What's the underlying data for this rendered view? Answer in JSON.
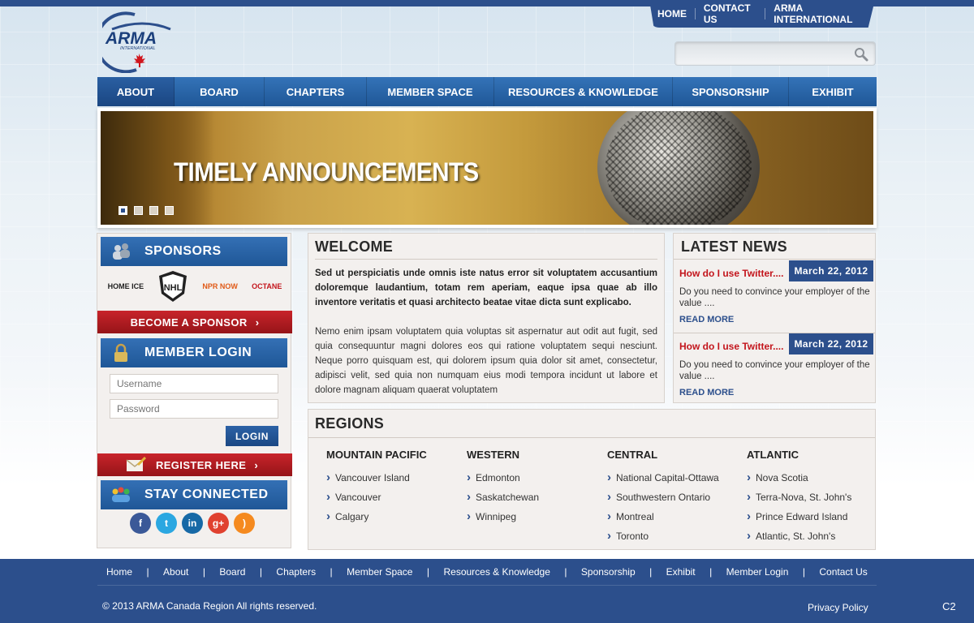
{
  "topnav": {
    "home": "HOME",
    "contact": "CONTACT US",
    "intl": "ARMA INTERNATIONAL"
  },
  "logo": {
    "name": "ARMA",
    "sub": "INTERNATIONAL"
  },
  "search": {
    "placeholder": "",
    "value": ""
  },
  "mainnav": [
    {
      "label": "ABOUT"
    },
    {
      "label": "BOARD"
    },
    {
      "label": "CHAPTERS"
    },
    {
      "label": "MEMBER SPACE"
    },
    {
      "label": "RESOURCES & KNOWLEDGE"
    },
    {
      "label": "SPONSORSHIP"
    },
    {
      "label": "EXHIBIT"
    }
  ],
  "banner": {
    "title": "TIMELY ANNOUNCEMENTS"
  },
  "sidebar": {
    "sponsors_title": "SPONSORS",
    "sponsor_logos": [
      "HOME ICE",
      "NHL",
      "NPR NOW",
      "OCTANE"
    ],
    "become_sponsor": "BECOME A SPONSOR",
    "login_title": "MEMBER LOGIN",
    "username_placeholder": "Username",
    "password_placeholder": "Password",
    "login_button": "LOGIN",
    "register": "REGISTER HERE",
    "stay_title": "STAY CONNECTED"
  },
  "welcome": {
    "title": "WELCOME",
    "lead": "Sed ut perspiciatis unde omnis iste natus error sit voluptatem accusantium doloremque laudantium, totam rem aperiam, eaque ipsa quae ab illo inventore veritatis et quasi architecto beatae vitae dicta sunt explicabo.",
    "body": "Nemo enim ipsam voluptatem quia voluptas sit aspernatur aut odit aut fugit, sed quia consequuntur magni dolores eos qui ratione voluptatem sequi nesciunt. Neque porro quisquam est, qui dolorem ipsum quia dolor sit amet, consectetur, adipisci velit, sed quia non numquam eius modi tempora incidunt ut labore et dolore magnam aliquam quaerat voluptatem"
  },
  "news": {
    "title": "LATEST NEWS",
    "items": [
      {
        "title": "How do I use Twitter....",
        "date": "March 22, 2012",
        "text": "Do you need to convince your employer of the value ....",
        "more": "READ MORE"
      },
      {
        "title": "How do I use Twitter....",
        "date": "March 22, 2012",
        "text": "Do you need to convince your employer of the value ....",
        "more": "READ MORE"
      }
    ]
  },
  "regions": {
    "title": "REGIONS",
    "cols": [
      {
        "name": "MOUNTAIN PACIFIC",
        "items": [
          "Vancouver Island",
          "Vancouver",
          "Calgary"
        ]
      },
      {
        "name": "WESTERN",
        "items": [
          "Edmonton",
          "Saskatchewan",
          "Winnipeg"
        ]
      },
      {
        "name": "CENTRAL",
        "items": [
          "National Capital-Ottawa",
          "Southwestern Ontario",
          "Montreal",
          "Toronto"
        ]
      },
      {
        "name": "ATLANTIC",
        "items": [
          "Nova Scotia",
          "Terra-Nova, St. John's",
          "Prince Edward Island",
          "Atlantic, St. John's"
        ]
      }
    ]
  },
  "footer": {
    "links": [
      "Home",
      "About",
      "Board",
      "Chapters",
      "Member Space",
      "Resources & Knowledge",
      "Sponsorship",
      "Exhibit",
      "Member Login",
      "Contact Us"
    ],
    "copyright": "© 2013 ARMA Canada Region All rights reserved.",
    "privacy": "Privacy Policy",
    "code": "C2"
  },
  "colors": {
    "brand_blue": "#2c4f8c",
    "accent_red": "#c3151c"
  }
}
